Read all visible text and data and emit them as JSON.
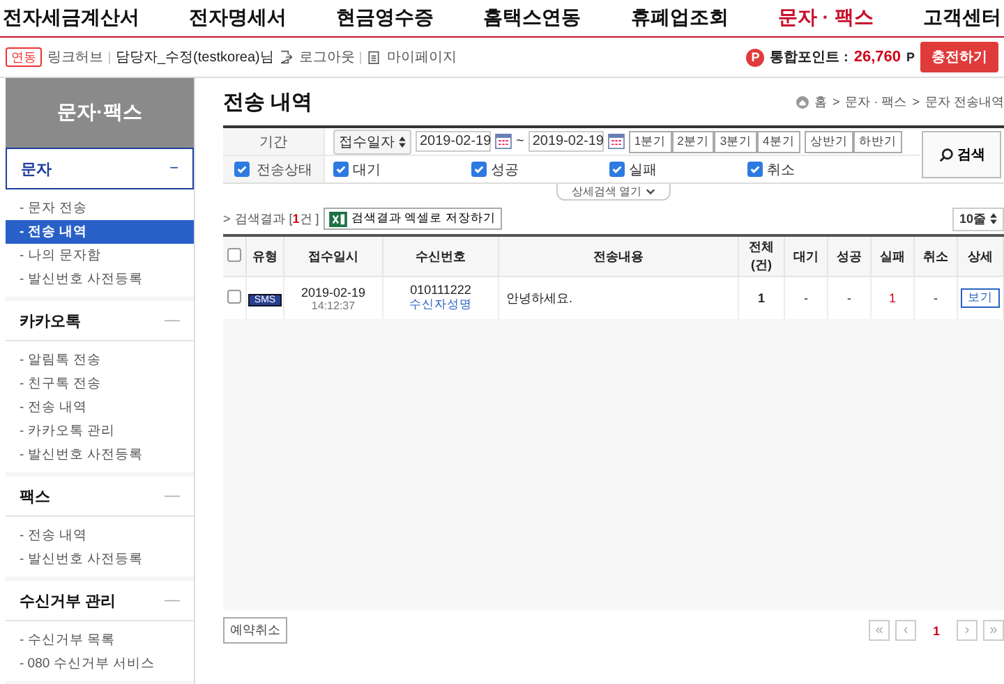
{
  "top_nav": [
    {
      "label": "전자세금계산서",
      "selected": false
    },
    {
      "label": "전자명세서",
      "selected": false
    },
    {
      "label": "현금영수증",
      "selected": false
    },
    {
      "label": "홈택스연동",
      "selected": false
    },
    {
      "label": "휴폐업조회",
      "selected": false
    },
    {
      "label": "문자 · 팩스",
      "selected": true
    },
    {
      "label": "고객센터",
      "selected": false
    }
  ],
  "user_bar": {
    "badge": "연동",
    "company": "링크허브",
    "user": "담당자_수정(testkorea)님",
    "logout": "로그아웃",
    "mypage": "마이페이지",
    "points_badge": "P",
    "points_label": "통합포인트 :",
    "points": "26,760",
    "points_unit": "P",
    "charge": "충전하기"
  },
  "sidebar": {
    "title": "문자·팩스",
    "sections": [
      {
        "title": "문자",
        "toggle": "−",
        "selected": true,
        "items": [
          {
            "label": "- 문자 전송",
            "selected": false
          },
          {
            "label": "- 전송 내역",
            "selected": true
          },
          {
            "label": "- 나의 문자함",
            "selected": false
          },
          {
            "label": "- 발신번호 사전등록",
            "selected": false
          }
        ]
      },
      {
        "title": "카카오톡",
        "toggle": "—",
        "selected": false,
        "items": [
          {
            "label": "- 알림톡 전송",
            "selected": false
          },
          {
            "label": "- 친구톡 전송",
            "selected": false
          },
          {
            "label": "- 전송 내역",
            "selected": false
          },
          {
            "label": "- 카카오톡 관리",
            "selected": false
          },
          {
            "label": "- 발신번호 사전등록",
            "selected": false
          }
        ]
      },
      {
        "title": "팩스",
        "toggle": "—",
        "selected": false,
        "items": [
          {
            "label": "- 전송 내역",
            "selected": false
          },
          {
            "label": "- 발신번호 사전등록",
            "selected": false
          }
        ]
      },
      {
        "title": "수신거부 관리",
        "toggle": "—",
        "selected": false,
        "items": [
          {
            "label": "- 수신거부 목록",
            "selected": false
          },
          {
            "label": "- 080 수신거부 서비스",
            "selected": false
          }
        ]
      }
    ]
  },
  "page": {
    "title": "전송 내역",
    "breadcrumb": [
      "홈",
      ">",
      "문자 · 팩스",
      ">",
      "문자 전송내역"
    ]
  },
  "filter": {
    "period_label": "기간",
    "date_type": "접수일자",
    "date_from": "2019-02-19",
    "date_sep": "~",
    "date_to": "2019-02-19",
    "quarters": [
      "1분기",
      "2분기",
      "3분기",
      "4분기"
    ],
    "halves": [
      "상반기",
      "하반기"
    ],
    "status": {
      "label": "전송상태",
      "checked": true,
      "options": [
        {
          "label": "대기",
          "checked": true
        },
        {
          "label": "성공",
          "checked": true
        },
        {
          "label": "실패",
          "checked": true
        },
        {
          "label": "취소",
          "checked": true
        }
      ]
    },
    "search_button": "검색",
    "detail_toggle": "상세검색 열기"
  },
  "results": {
    "arrow": ">",
    "label": "검색결과",
    "count_prefix": "[",
    "count": "1",
    "count_suffix": "건 ]",
    "excel_button": "검색결과 엑셀로 저장하기",
    "page_size": "10줄"
  },
  "table": {
    "select_all_checked": false,
    "columns": [
      "유형",
      "접수일시",
      "수신번호",
      "전송내용",
      "전체 (건)",
      "대기",
      "성공",
      "실패",
      "취소",
      "상세"
    ],
    "rows": [
      {
        "checked": false,
        "type": "SMS",
        "date": "2019-02-19",
        "time": "14:12:37",
        "number": "010111222",
        "name": "수신자성명",
        "content": "안녕하세요.",
        "total": "1",
        "waiting": "-",
        "success": "-",
        "fail": "1",
        "cancel": "-",
        "detail": "보기"
      }
    ]
  },
  "footer": {
    "cancel_button": "예약취소",
    "first": "«",
    "prev": "‹",
    "pages": [
      {
        "label": "1",
        "selected": true
      }
    ],
    "next": "›",
    "last": "»"
  }
}
